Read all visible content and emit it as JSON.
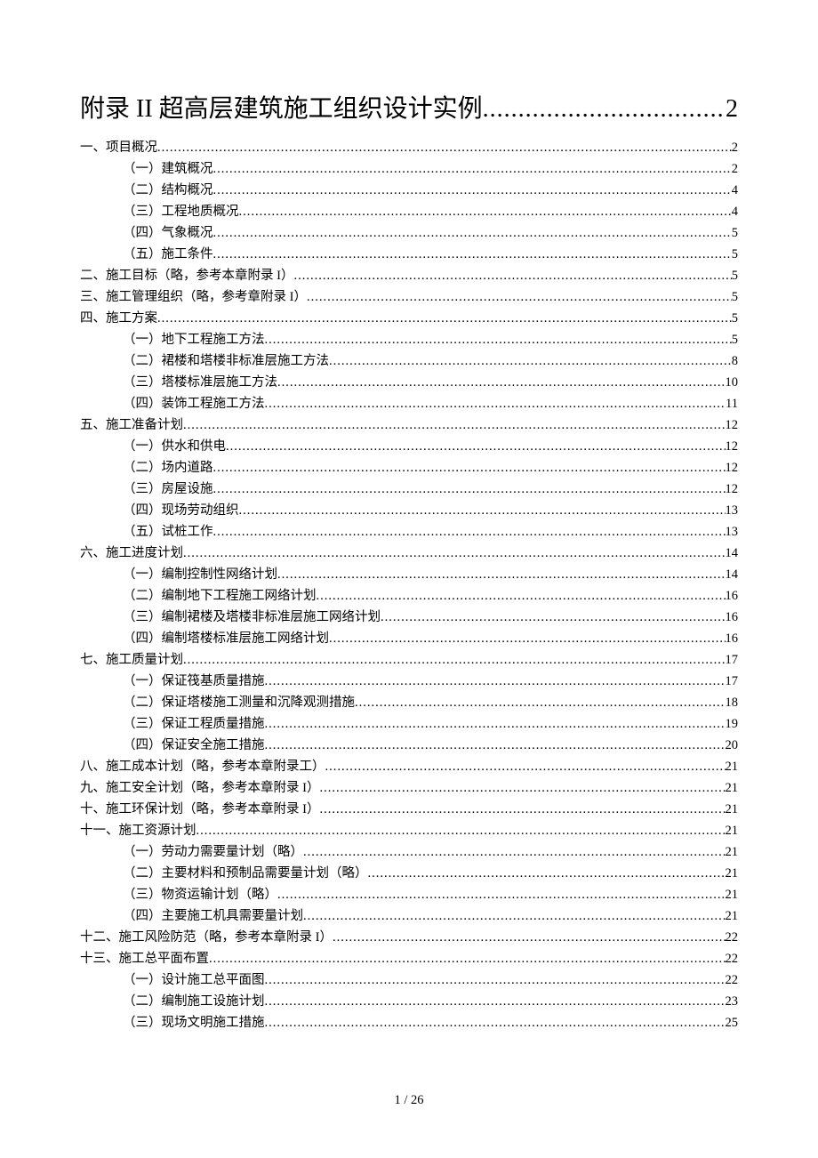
{
  "title": {
    "label": "附录 II 超高层建筑施工组织设计实例",
    "page": "2"
  },
  "footer": "1 / 26",
  "toc": [
    {
      "level": 1,
      "label": "一、项目概况",
      "page": "2"
    },
    {
      "level": 2,
      "label": "（一）建筑概况",
      "page": "2"
    },
    {
      "level": 2,
      "label": "（二）结构概况",
      "page": "4"
    },
    {
      "level": 2,
      "label": "（三）工程地质概况",
      "page": "4"
    },
    {
      "level": 2,
      "label": "（四）气象概况",
      "page": "5"
    },
    {
      "level": 2,
      "label": "（五）施工条件",
      "page": "5"
    },
    {
      "level": 1,
      "label": "二、施工目标（略，参考本章附录 I）",
      "page": "5"
    },
    {
      "level": 1,
      "label": "三、施工管理组织（略，参考章附录 I）",
      "page": "5"
    },
    {
      "level": 1,
      "label": "四、施工方案",
      "page": "5"
    },
    {
      "level": 2,
      "label": "（一）地下工程施工方法",
      "page": "5"
    },
    {
      "level": 2,
      "label": "（二）裙楼和塔楼非标准层施工方法",
      "page": "8"
    },
    {
      "level": 2,
      "label": "（三）塔楼标准层施工方法",
      "page": "10"
    },
    {
      "level": 2,
      "label": "（四）装饰工程施工方法",
      "page": "11"
    },
    {
      "level": 1,
      "label": "五、施工准备计划",
      "page": "12"
    },
    {
      "level": 2,
      "label": "（一）供水和供电",
      "page": "12"
    },
    {
      "level": 2,
      "label": "（二）场内道路",
      "page": "12"
    },
    {
      "level": 2,
      "label": "（三）房屋设施",
      "page": "12"
    },
    {
      "level": 2,
      "label": "（四）现场劳动组织",
      "page": "13"
    },
    {
      "level": 2,
      "label": "（五）试桩工作",
      "page": "13"
    },
    {
      "level": 1,
      "label": "六、施工进度计划",
      "page": "14"
    },
    {
      "level": 2,
      "label": "（一）编制控制性网络计划",
      "page": "14"
    },
    {
      "level": 2,
      "label": "（二）编制地下工程施工网络计划",
      "page": "16"
    },
    {
      "level": 2,
      "label": "（三）编制裙楼及塔楼非标准层施工网络计划",
      "page": "16"
    },
    {
      "level": 2,
      "label": "（四）编制塔楼标准层施工网络计划",
      "page": "16"
    },
    {
      "level": 1,
      "label": "七、施工质量计划",
      "page": "17"
    },
    {
      "level": 2,
      "label": "（一）保证筏基质量措施",
      "page": "17"
    },
    {
      "level": 2,
      "label": "（二）保证塔楼施工测量和沉降观测措施",
      "page": "18"
    },
    {
      "level": 2,
      "label": "（三）保证工程质量措施",
      "page": "19"
    },
    {
      "level": 2,
      "label": "（四）保证安全施工措施",
      "page": "20"
    },
    {
      "level": 1,
      "label": "八、施工成本计划（略，参考本章附录工）",
      "page": "21"
    },
    {
      "level": 1,
      "label": "九、施工安全计划（略，参考本章附录 I）",
      "page": "21"
    },
    {
      "level": 1,
      "label": "十、施工环保计划（略，参考本章附录 I）",
      "page": "21"
    },
    {
      "level": 1,
      "label": "十一、施工资源计划",
      "page": "21"
    },
    {
      "level": 2,
      "label": "（一）劳动力需要量计划（略）",
      "page": "21"
    },
    {
      "level": 2,
      "label": "（二）主要材料和预制品需要量计划（略）",
      "page": "21"
    },
    {
      "level": 2,
      "label": "（三）物资运输计划（略）",
      "page": "21"
    },
    {
      "level": 2,
      "label": "（四）主要施工机具需要量计划",
      "page": "21"
    },
    {
      "level": 1,
      "label": "十二、施工风险防范（略，参考本章附录 I）",
      "page": "22"
    },
    {
      "level": 1,
      "label": "十三、施工总平面布置",
      "page": "22"
    },
    {
      "level": 2,
      "label": "（一）设计施工总平面图",
      "page": "22"
    },
    {
      "level": 2,
      "label": "（二）编制施工设施计划",
      "page": "23"
    },
    {
      "level": 2,
      "label": "（三）现场文明施工措施",
      "page": "25"
    }
  ]
}
